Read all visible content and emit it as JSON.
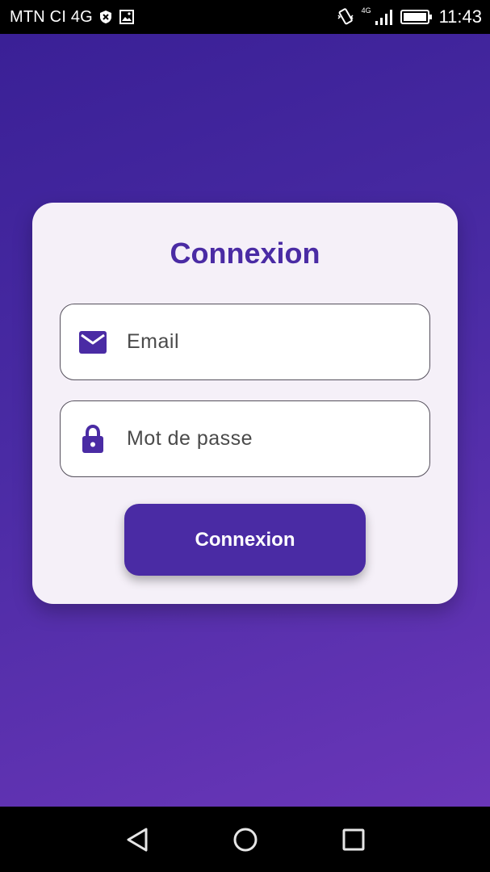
{
  "status_bar": {
    "carrier": "MTN CI 4G",
    "network_label": "4G",
    "time": "11:43",
    "icons": [
      "shield-icon",
      "image-icon",
      "vibrate-icon",
      "signal-icon",
      "battery-icon"
    ]
  },
  "login": {
    "title": "Connexion",
    "email_placeholder": "Email",
    "password_placeholder": "Mot de passe",
    "submit_label": "Connexion",
    "email_icon": "mail-icon",
    "password_icon": "lock-icon"
  },
  "nav_bar": {
    "icons": [
      "back-icon",
      "home-icon",
      "recents-icon"
    ]
  },
  "colors": {
    "accent": "#4a2ba4",
    "card_background": "#f5f0f8",
    "gradient_start": "#3a2096",
    "gradient_end": "#6a36b8"
  }
}
